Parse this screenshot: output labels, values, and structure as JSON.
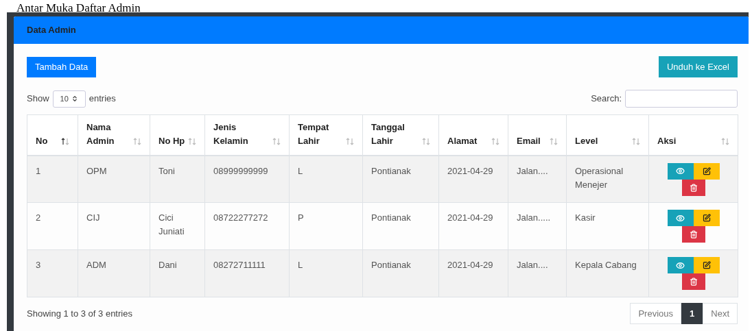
{
  "page_title": "Antar Muka Daftar Admin",
  "card": {
    "title": "Data Admin"
  },
  "buttons": {
    "add": "Tambah Data",
    "export": "Unduh ke Excel"
  },
  "length": {
    "prefix": "Show",
    "value": "10",
    "suffix": "entries"
  },
  "search": {
    "label": "Search:"
  },
  "table": {
    "columns": [
      {
        "label": "No",
        "sorted": true
      },
      {
        "label": "Nama Admin",
        "sorted": false
      },
      {
        "label": "No Hp",
        "sorted": false
      },
      {
        "label": "Jenis Kelamin",
        "sorted": false
      },
      {
        "label": "Tempat Lahir",
        "sorted": false
      },
      {
        "label": "Tanggal Lahir",
        "sorted": false
      },
      {
        "label": "Alamat",
        "sorted": false
      },
      {
        "label": "Email",
        "sorted": false
      },
      {
        "label": "Level",
        "sorted": false
      },
      {
        "label": "Aksi",
        "sorted": false
      }
    ],
    "rows": [
      {
        "cells": [
          "1",
          "OPM",
          "Toni",
          "08999999999",
          "L",
          "Pontianak",
          "2021-04-29",
          "Jalan....",
          "Operasional Menejer"
        ]
      },
      {
        "cells": [
          "2",
          "CIJ",
          "Cici Juniati",
          "08722277272",
          "P",
          "Pontianak",
          "2021-04-29",
          "Jalan.....",
          "Kasir"
        ]
      },
      {
        "cells": [
          "3",
          "ADM",
          "Dani",
          "08272711111",
          "L",
          "Pontianak",
          "2021-04-29",
          "Jalan....",
          "Kepala Cabang"
        ]
      }
    ]
  },
  "info": "Showing 1 to 3 of 3 entries",
  "pagination": [
    {
      "label": "Previous",
      "selected": false,
      "disabled": true
    },
    {
      "label": "1",
      "selected": true,
      "disabled": false
    },
    {
      "label": "Next",
      "selected": false,
      "disabled": true
    }
  ]
}
